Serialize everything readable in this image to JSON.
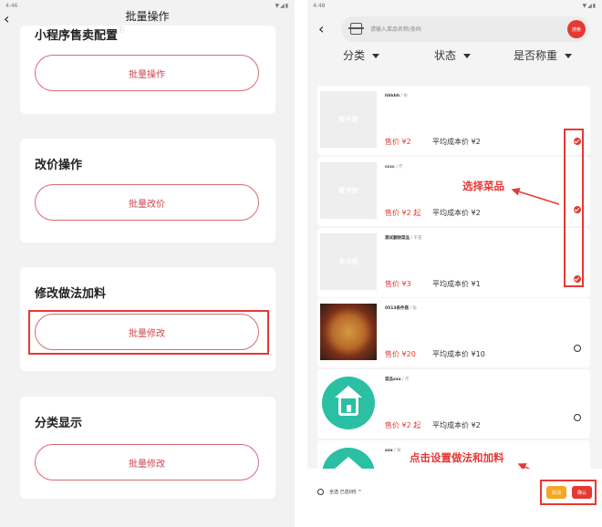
{
  "status_left": {
    "time": "4:46",
    "icons": "▼◢▮"
  },
  "status_right": {
    "time": "4:48",
    "icons": "▼◢▮"
  },
  "left": {
    "title": "批量操作",
    "cards": [
      {
        "title": "小程序售卖配置",
        "hint": "ⓘ",
        "button": "批量操作"
      },
      {
        "title": "改价操作",
        "button": "批量改价"
      },
      {
        "title": "修改做法加料",
        "button": "批量修改"
      },
      {
        "title": "分类显示",
        "button": "批量修改"
      }
    ]
  },
  "right": {
    "search": {
      "placeholder": "请输入菜品名称/条码",
      "button": "搜索"
    },
    "filters": [
      "分类",
      "状态",
      "是否称重"
    ],
    "items": [
      {
        "name": "hhhhh",
        "unit": " / 份",
        "price": "售价 ¥2",
        "cost": "平均成本价 ¥2",
        "image": "placeholder",
        "checked": true
      },
      {
        "name": "cccc",
        "unit": " / 斤",
        "price": "售价 ¥2 起",
        "cost": "平均成本价 ¥2",
        "image": "placeholder",
        "checked": true
      },
      {
        "name": "测试删除菜品",
        "unit": " / 千克",
        "price": "售价 ¥3",
        "cost": "平均成本价 ¥1",
        "image": "placeholder",
        "checked": true
      },
      {
        "name": "0513条件搭",
        "unit": " / 份",
        "price": "售价 ¥20",
        "cost": "平均成本价 ¥10",
        "image": "noodle",
        "checked": false
      },
      {
        "name": "菜品xxx",
        "unit": " / 斤",
        "price": "售价 ¥2 起",
        "cost": "平均成本价 ¥2",
        "image": "app",
        "checked": false
      },
      {
        "name": "xxx",
        "unit": " / 份",
        "price": "",
        "cost": "",
        "image": "app",
        "checked": false
      }
    ],
    "placeholder_mark": "收卡控",
    "annotations": {
      "select": "选择菜品",
      "set": "点击设置做法和加料"
    },
    "footer": {
      "select_all": "全选 已选0份 ^",
      "btn1": "取消",
      "btn2": "确认"
    },
    "colors": {
      "accent": "#e53935",
      "teal": "#2bbfa3",
      "orange": "#f5a623"
    }
  }
}
